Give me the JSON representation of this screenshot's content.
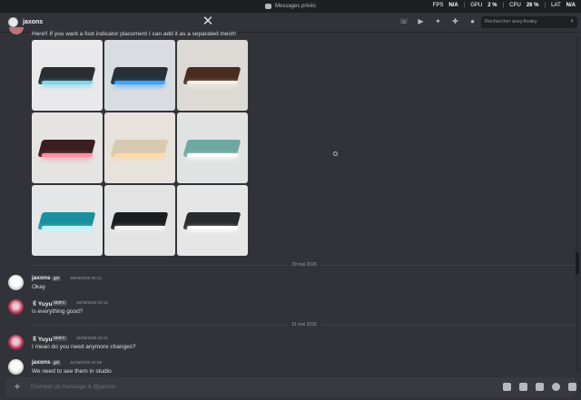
{
  "titlebar": {
    "title": "Messages privés"
  },
  "overlay": {
    "fps_label": "FPS",
    "fps_value": "N/A",
    "gpu_label": "GPU",
    "gpu_value": "2 %",
    "cpu_label": "CPU",
    "cpu_value": "26 %",
    "lat_label": "LAT",
    "lat_value": "N/A"
  },
  "header": {
    "channel_name": "jaxons",
    "search_placeholder": "Rechercher acey.freaky"
  },
  "icons": [
    "close-icon",
    "phone-call-icon",
    "video-call-icon",
    "pin-icon",
    "add-friends-icon",
    "user-profile-icon",
    "search-icon",
    "plus-icon",
    "gift-icon",
    "gif-icon",
    "sticker-icon",
    "emoji-icon",
    "apps-icon",
    "loading-spinner-icon"
  ],
  "first_message": {
    "text": "Here!! If you want a foot indicator placement I can add it as a separated mesh!"
  },
  "gallery": {
    "tiles": [
      {
        "bg": "#e9e9ec",
        "plate": "#2a2e33",
        "glow": "#7fd6e8"
      },
      {
        "bg": "#d9dde2",
        "plate": "#273038",
        "glow": "#3da5ff"
      },
      {
        "bg": "#ddd9d4",
        "plate": "#4a2c20",
        "glow": "#f4f0e8"
      },
      {
        "bg": "#e6e4e3",
        "plate": "#3a1e22",
        "glow": "#ff8fa0"
      },
      {
        "bg": "#e7e2dc",
        "plate": "#d8c9b3",
        "glow": "#ffd9a8"
      },
      {
        "bg": "#e1e3e3",
        "plate": "#6fa8a0",
        "glow": "#ffffff"
      },
      {
        "bg": "#e4e6e8",
        "plate": "#1a8f9e",
        "glow": "#bff3ff"
      },
      {
        "bg": "#e3e3e3",
        "plate": "#1b1c1e",
        "glow": "#f3f3f3"
      },
      {
        "bg": "#e6e6e6",
        "plate": "#2a2b2d",
        "glow": "#ffffff"
      }
    ]
  },
  "dividers": {
    "d1": "29 mai 2026",
    "d2": "31 mai 2026"
  },
  "messages": [
    {
      "author": "jaxons",
      "tag": "girl",
      "timestamp": "29/05/2026 00:11",
      "text": "Okay"
    },
    {
      "author": "ꉂ Yuyu",
      "tag": "SMFC",
      "timestamp": "29/05/2026 00:12",
      "text": "is everything good?"
    },
    {
      "author": "ꉂ Yuyu",
      "tag": "SMFC",
      "timestamp": "31/05/2026 04:21",
      "text": "I mean do you need anymore changes?"
    },
    {
      "author": "jaxons",
      "tag": "girl",
      "timestamp": "31/05/2026 04:59",
      "text": "We need to see them in studio"
    }
  ],
  "composer": {
    "placeholder": "Envoyer un message à @jaxons"
  }
}
